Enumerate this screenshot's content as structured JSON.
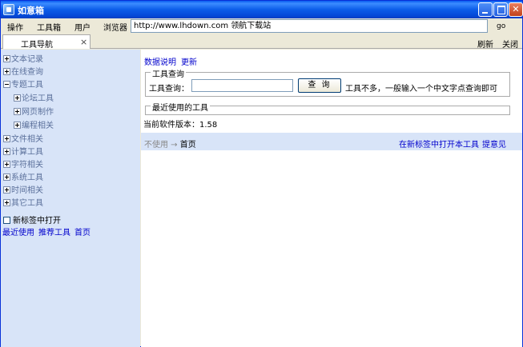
{
  "window": {
    "title": "如意箱"
  },
  "menu": {
    "items": [
      "操作",
      "工具箱",
      "用户",
      "浏览器"
    ],
    "address": "http://www.lhdown.com 领航下载站",
    "go": "go"
  },
  "tabs": {
    "active_label": "工具导航",
    "close": "×",
    "refresh": "刷新",
    "close_all": "关闭"
  },
  "sidebar": {
    "tree": [
      {
        "label": "文本记录",
        "level": 0,
        "expanded": false
      },
      {
        "label": "在线查询",
        "level": 0,
        "expanded": false
      },
      {
        "label": "专题工具",
        "level": 0,
        "expanded": true
      },
      {
        "label": "论坛工具",
        "level": 1,
        "expanded": false
      },
      {
        "label": "网页制作",
        "level": 1,
        "expanded": false
      },
      {
        "label": "编程相关",
        "level": 1,
        "expanded": false
      },
      {
        "label": "文件相关",
        "level": 0,
        "expanded": false
      },
      {
        "label": "计算工具",
        "level": 0,
        "expanded": false
      },
      {
        "label": "字符相关",
        "level": 0,
        "expanded": false
      },
      {
        "label": "系统工具",
        "level": 0,
        "expanded": false
      },
      {
        "label": "时间相关",
        "level": 0,
        "expanded": false
      },
      {
        "label": "其它工具",
        "level": 0,
        "expanded": false
      }
    ],
    "new_tab_checkbox": "新标签中打开",
    "links": [
      "最近使用",
      "推荐工具",
      "首页"
    ]
  },
  "main": {
    "top_links": [
      "数据说明",
      "更新"
    ],
    "query": {
      "legend": "工具查询",
      "label": "工具查询：",
      "input_value": "",
      "button": "查 询",
      "hint": "工具不多，一般输入一个中文字点查询即可"
    },
    "recent": {
      "legend": "最近使用的工具"
    },
    "version": "当前软件版本：1.58",
    "status": {
      "left": "不使用 → ",
      "home": "首页",
      "right_links": [
        "在新标签中打开本工具",
        "提意见"
      ]
    }
  }
}
